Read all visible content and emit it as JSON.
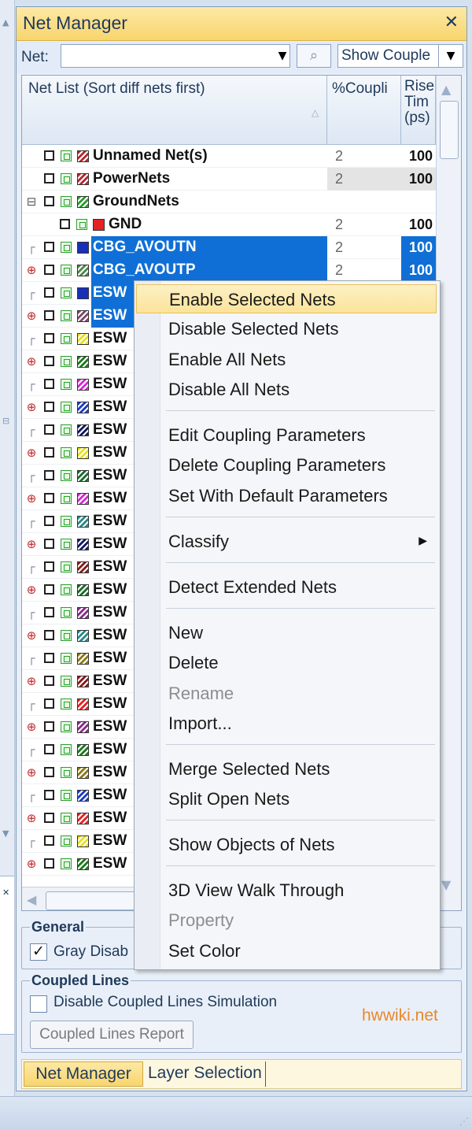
{
  "panel": {
    "title": "Net Manager",
    "close_glyph": "✕",
    "net_label": "Net:",
    "net_value": "",
    "show_couple": "Show Couple",
    "drop_glyph": "▼",
    "search_glyph": "⌕"
  },
  "grid": {
    "headers": {
      "net_list": "Net List (Sort diff nets first)",
      "coupling": "%Coupli",
      "rise_1": "Rise",
      "rise_2": "Tim",
      "rise_3": "(ps)"
    },
    "rows": [
      {
        "tree": "",
        "indent": 1,
        "color": "#b3282d",
        "name": "Unnamed Net(s)",
        "coupling": "2",
        "rise": "100",
        "style": "",
        "hatch": true
      },
      {
        "tree": "",
        "indent": 1,
        "color": "#b3282d",
        "name": "PowerNets",
        "coupling": "2",
        "rise": "100",
        "style": "gray",
        "hatch": true
      },
      {
        "tree": "⊟",
        "indent": 1,
        "color": "#2e9a2e",
        "name": "GroundNets",
        "coupling": "",
        "rise": "",
        "style": "",
        "hatch": true
      },
      {
        "tree": "",
        "indent": 2,
        "color": "#e52222",
        "name": "GND",
        "coupling": "2",
        "rise": "100",
        "style": "",
        "hatch": false
      },
      {
        "tree": "┌",
        "indent": 1,
        "color": "#1a2fb8",
        "name": "CBG_AVOUTN",
        "coupling": "2",
        "rise": "100",
        "style": "sel",
        "hatch": false
      },
      {
        "tree": "⊕",
        "indent": 1,
        "color": "#4a8a4a",
        "name": "CBG_AVOUTP",
        "coupling": "2",
        "rise": "100",
        "style": "sel",
        "hatch": true
      },
      {
        "tree": "┌",
        "indent": 1,
        "color": "#1a2fb8",
        "name": "ESW",
        "coupling": "",
        "rise": "",
        "style": "sel",
        "hatch": false
      },
      {
        "tree": "⊕",
        "indent": 1,
        "color": "#7a4a6a",
        "name": "ESW",
        "coupling": "",
        "rise": "",
        "style": "sel",
        "hatch": true
      },
      {
        "tree": "┌",
        "indent": 1,
        "color": "#e8e01a",
        "name": "ESW",
        "coupling": "",
        "rise": "",
        "style": "",
        "hatch": true
      },
      {
        "tree": "⊕",
        "indent": 1,
        "color": "#1d7a1d",
        "name": "ESW",
        "coupling": "",
        "rise": "",
        "style": "",
        "hatch": true
      },
      {
        "tree": "┌",
        "indent": 1,
        "color": "#d42ad4",
        "name": "ESW",
        "coupling": "",
        "rise": "",
        "style": "",
        "hatch": true
      },
      {
        "tree": "⊕",
        "indent": 1,
        "color": "#1a3ac8",
        "name": "ESW",
        "coupling": "",
        "rise": "",
        "style": "",
        "hatch": true
      },
      {
        "tree": "┌",
        "indent": 1,
        "color": "#121a66",
        "name": "ESW",
        "coupling": "",
        "rise": "",
        "style": "",
        "hatch": true
      },
      {
        "tree": "⊕",
        "indent": 1,
        "color": "#e8e01a",
        "name": "ESW",
        "coupling": "",
        "rise": "",
        "style": "",
        "hatch": true
      },
      {
        "tree": "┌",
        "indent": 1,
        "color": "#1d6a2a",
        "name": "ESW",
        "coupling": "",
        "rise": "",
        "style": "",
        "hatch": true
      },
      {
        "tree": "⊕",
        "indent": 1,
        "color": "#d42ad4",
        "name": "ESW",
        "coupling": "",
        "rise": "",
        "style": "",
        "hatch": true
      },
      {
        "tree": "┌",
        "indent": 1,
        "color": "#2a8a8a",
        "name": "ESW",
        "coupling": "",
        "rise": "",
        "style": "",
        "hatch": true
      },
      {
        "tree": "⊕",
        "indent": 1,
        "color": "#121a66",
        "name": "ESW",
        "coupling": "",
        "rise": "",
        "style": "",
        "hatch": true
      },
      {
        "tree": "┌",
        "indent": 1,
        "color": "#8a1a1a",
        "name": "ESW",
        "coupling": "",
        "rise": "",
        "style": "",
        "hatch": true
      },
      {
        "tree": "⊕",
        "indent": 1,
        "color": "#1d6a2a",
        "name": "ESW",
        "coupling": "",
        "rise": "",
        "style": "",
        "hatch": true
      },
      {
        "tree": "┌",
        "indent": 1,
        "color": "#8a2a8a",
        "name": "ESW",
        "coupling": "",
        "rise": "",
        "style": "",
        "hatch": true
      },
      {
        "tree": "⊕",
        "indent": 1,
        "color": "#2a8a8a",
        "name": "ESW",
        "coupling": "",
        "rise": "",
        "style": "",
        "hatch": true
      },
      {
        "tree": "┌",
        "indent": 1,
        "color": "#8a7a1a",
        "name": "ESW",
        "coupling": "",
        "rise": "",
        "style": "",
        "hatch": true
      },
      {
        "tree": "⊕",
        "indent": 1,
        "color": "#8a1a1a",
        "name": "ESW",
        "coupling": "",
        "rise": "",
        "style": "",
        "hatch": true
      },
      {
        "tree": "┌",
        "indent": 1,
        "color": "#e52222",
        "name": "ESW",
        "coupling": "",
        "rise": "",
        "style": "",
        "hatch": true
      },
      {
        "tree": "⊕",
        "indent": 1,
        "color": "#8a2a8a",
        "name": "ESW",
        "coupling": "",
        "rise": "",
        "style": "",
        "hatch": true
      },
      {
        "tree": "┌",
        "indent": 1,
        "color": "#1d7a1d",
        "name": "ESW",
        "coupling": "",
        "rise": "",
        "style": "",
        "hatch": true
      },
      {
        "tree": "⊕",
        "indent": 1,
        "color": "#8a7a1a",
        "name": "ESW",
        "coupling": "",
        "rise": "",
        "style": "",
        "hatch": true
      },
      {
        "tree": "┌",
        "indent": 1,
        "color": "#1a3ac8",
        "name": "ESW",
        "coupling": "",
        "rise": "",
        "style": "",
        "hatch": true
      },
      {
        "tree": "⊕",
        "indent": 1,
        "color": "#e52222",
        "name": "ESW",
        "coupling": "",
        "rise": "",
        "style": "",
        "hatch": true
      },
      {
        "tree": "┌",
        "indent": 1,
        "color": "#e8e01a",
        "name": "ESW",
        "coupling": "",
        "rise": "",
        "style": "",
        "hatch": true
      },
      {
        "tree": "⊕",
        "indent": 1,
        "color": "#1d7a1d",
        "name": "ESW",
        "coupling": "",
        "rise": "",
        "style": "",
        "hatch": true
      }
    ]
  },
  "context_menu": {
    "items": [
      {
        "label": "Enable Selected Nets",
        "state": "hl",
        "submenu": false
      },
      {
        "label": "Disable Selected Nets",
        "state": "",
        "submenu": false
      },
      {
        "label": "Enable All Nets",
        "state": "",
        "submenu": false
      },
      {
        "label": "Disable All Nets",
        "state": "",
        "submenu": false
      },
      {
        "label": "Edit Coupling Parameters",
        "state": "",
        "submenu": false
      },
      {
        "label": "Delete Coupling Parameters",
        "state": "",
        "submenu": false
      },
      {
        "label": "Set With Default Parameters",
        "state": "",
        "submenu": false
      },
      {
        "label": "Classify",
        "state": "",
        "submenu": true
      },
      {
        "label": "Detect Extended Nets",
        "state": "",
        "submenu": false
      },
      {
        "label": "New",
        "state": "",
        "submenu": false
      },
      {
        "label": "Delete",
        "state": "",
        "submenu": false
      },
      {
        "label": "Rename",
        "state": "dis",
        "submenu": false
      },
      {
        "label": "Import...",
        "state": "",
        "submenu": false
      },
      {
        "label": "Merge Selected Nets",
        "state": "",
        "submenu": false
      },
      {
        "label": "Split Open Nets",
        "state": "",
        "submenu": false
      },
      {
        "label": "Show Objects of Nets",
        "state": "",
        "submenu": false
      },
      {
        "label": "3D View Walk Through",
        "state": "",
        "submenu": false
      },
      {
        "label": "Property",
        "state": "dis",
        "submenu": false
      },
      {
        "label": "Set Color",
        "state": "",
        "submenu": false
      }
    ],
    "submenu_glyph": "▶"
  },
  "general": {
    "legend": "General",
    "gray_disabled_label": "Gray Disab",
    "gray_disabled_checked": true
  },
  "coupled_lines": {
    "legend": "Coupled Lines",
    "disable_label": "Disable Coupled Lines Simulation",
    "disable_checked": false,
    "report_button": "Coupled Lines Report"
  },
  "watermark": "hwwiki.net",
  "tabs": {
    "net_manager": "Net Manager",
    "layer_selection": "Layer Selection"
  },
  "left_strip": {
    "up": "▲",
    "down": "▼",
    "mid": "⊟",
    "close": "✕"
  },
  "scroll": {
    "up": "▲",
    "down": "▼",
    "left": "◀"
  }
}
